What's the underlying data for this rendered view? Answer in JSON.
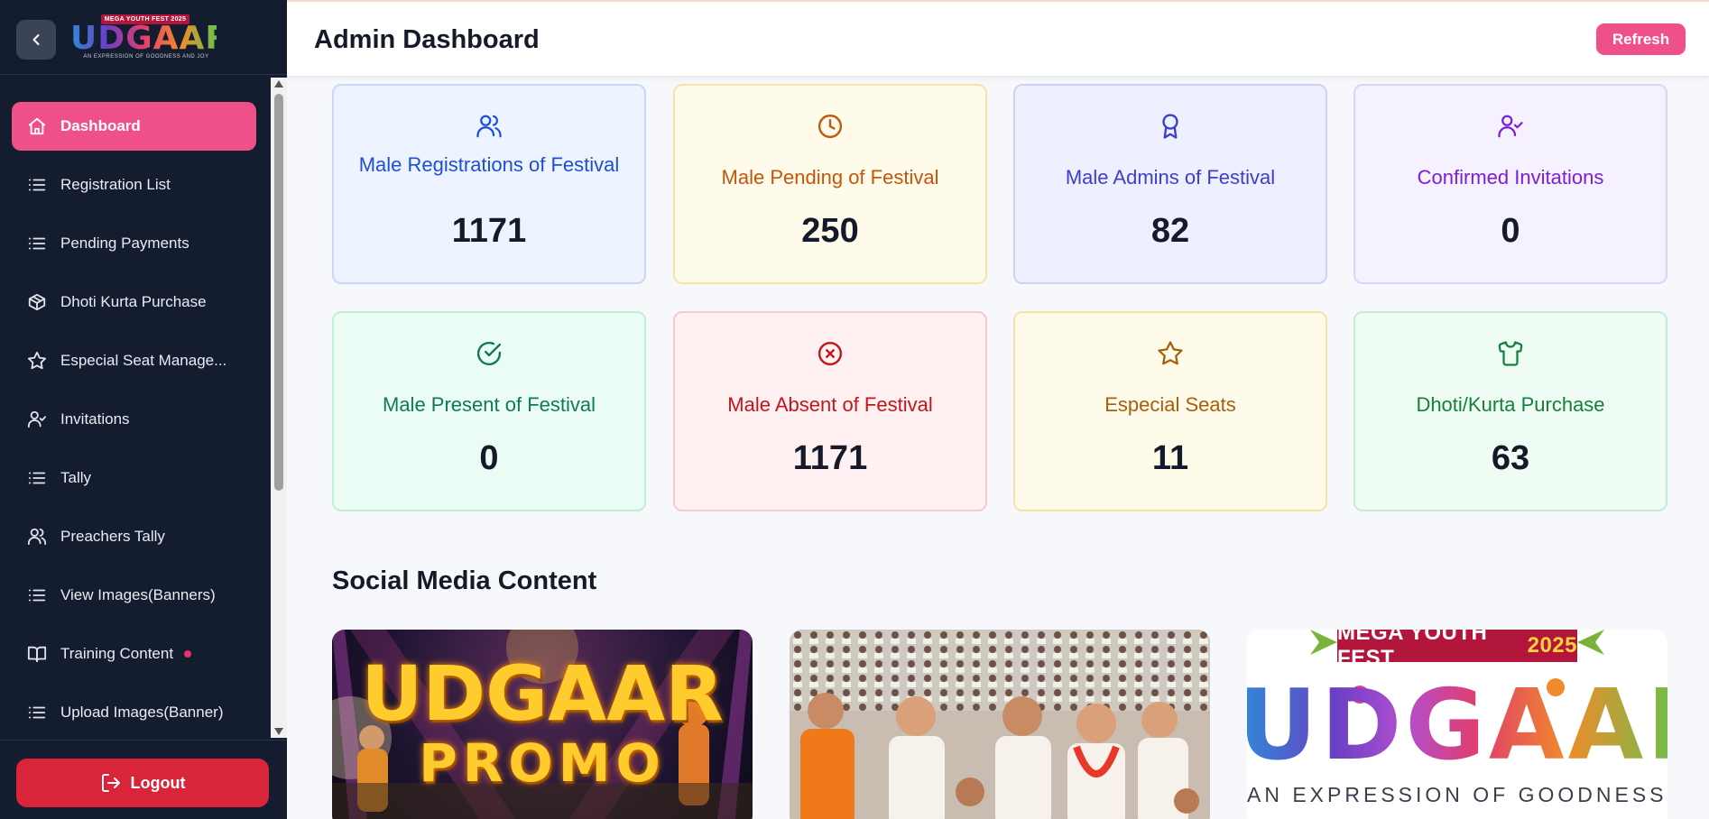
{
  "sidebar": {
    "logo": {
      "top_text": "MEGA YOUTH FEST 2025",
      "word": "UDGAAR",
      "tagline": "AN EXPRESSION OF GOODNESS AND JOY"
    },
    "items": [
      {
        "label": "Dashboard",
        "icon": "home-icon",
        "active": true
      },
      {
        "label": "Registration List",
        "icon": "list-icon"
      },
      {
        "label": "Pending Payments",
        "icon": "list-icon"
      },
      {
        "label": "Dhoti Kurta Purchase",
        "icon": "package-icon"
      },
      {
        "label": "Especial Seat Manage...",
        "icon": "star-icon"
      },
      {
        "label": "Invitations",
        "icon": "user-check-icon"
      },
      {
        "label": "Tally",
        "icon": "list-icon"
      },
      {
        "label": "Preachers Tally",
        "icon": "users-icon"
      },
      {
        "label": "View Images(Banners)",
        "icon": "list-icon"
      },
      {
        "label": "Training Content",
        "icon": "book-icon",
        "badge_dot": true
      },
      {
        "label": "Upload Images(Banner)",
        "icon": "list-icon"
      }
    ],
    "logout_label": "Logout"
  },
  "header": {
    "title": "Admin Dashboard",
    "refresh_label": "Refresh"
  },
  "stats": [
    {
      "label": "Male Registrations of Festival",
      "value": "1171",
      "icon": "users-icon",
      "color": "#1d4ed8",
      "bg": "#eef4ff",
      "border": "#c7d8f6"
    },
    {
      "label": "Male Pending of Festival",
      "value": "250",
      "icon": "clock-icon",
      "color": "#c2570c",
      "bg": "#fffbea",
      "border": "#f5e3a8"
    },
    {
      "label": "Male Admins of Festival",
      "value": "82",
      "icon": "award-icon",
      "color": "#3b3fc9",
      "bg": "#eef0ff",
      "border": "#cdd2f4"
    },
    {
      "label": "Confirmed Invitations",
      "value": "0",
      "icon": "user-check-icon",
      "color": "#7b1fd6",
      "bg": "#f5f1ff",
      "border": "#ddd3f7"
    },
    {
      "label": "Male Present of Festival",
      "value": "0",
      "icon": "check-circle-icon",
      "color": "#0f7a55",
      "bg": "#eafcf3",
      "border": "#bfeed7"
    },
    {
      "label": "Male Absent of Festival",
      "value": "1171",
      "icon": "x-circle-icon",
      "color": "#c4141c",
      "bg": "#fff1f1",
      "border": "#f6cbcb"
    },
    {
      "label": "Especial Seats",
      "value": "11",
      "icon": "star-icon",
      "color": "#a6600a",
      "bg": "#fffbea",
      "border": "#f5e3a8"
    },
    {
      "label": "Dhoti/Kurta Purchase",
      "value": "63",
      "icon": "shirt-icon",
      "color": "#15803d",
      "bg": "#eefcf3",
      "border": "#c3ecd2"
    }
  ],
  "social": {
    "title": "Social Media Content",
    "items": [
      {
        "line1": "UDGAAR",
        "line2": "PROMO"
      },
      {
        "alt": ""
      },
      {
        "banner": "MEGA YOUTH FEST",
        "banner_year": "2025",
        "word": "UDGAAR",
        "tagline": "AN EXPRESSION OF GOODNESS AND JOY"
      }
    ]
  }
}
